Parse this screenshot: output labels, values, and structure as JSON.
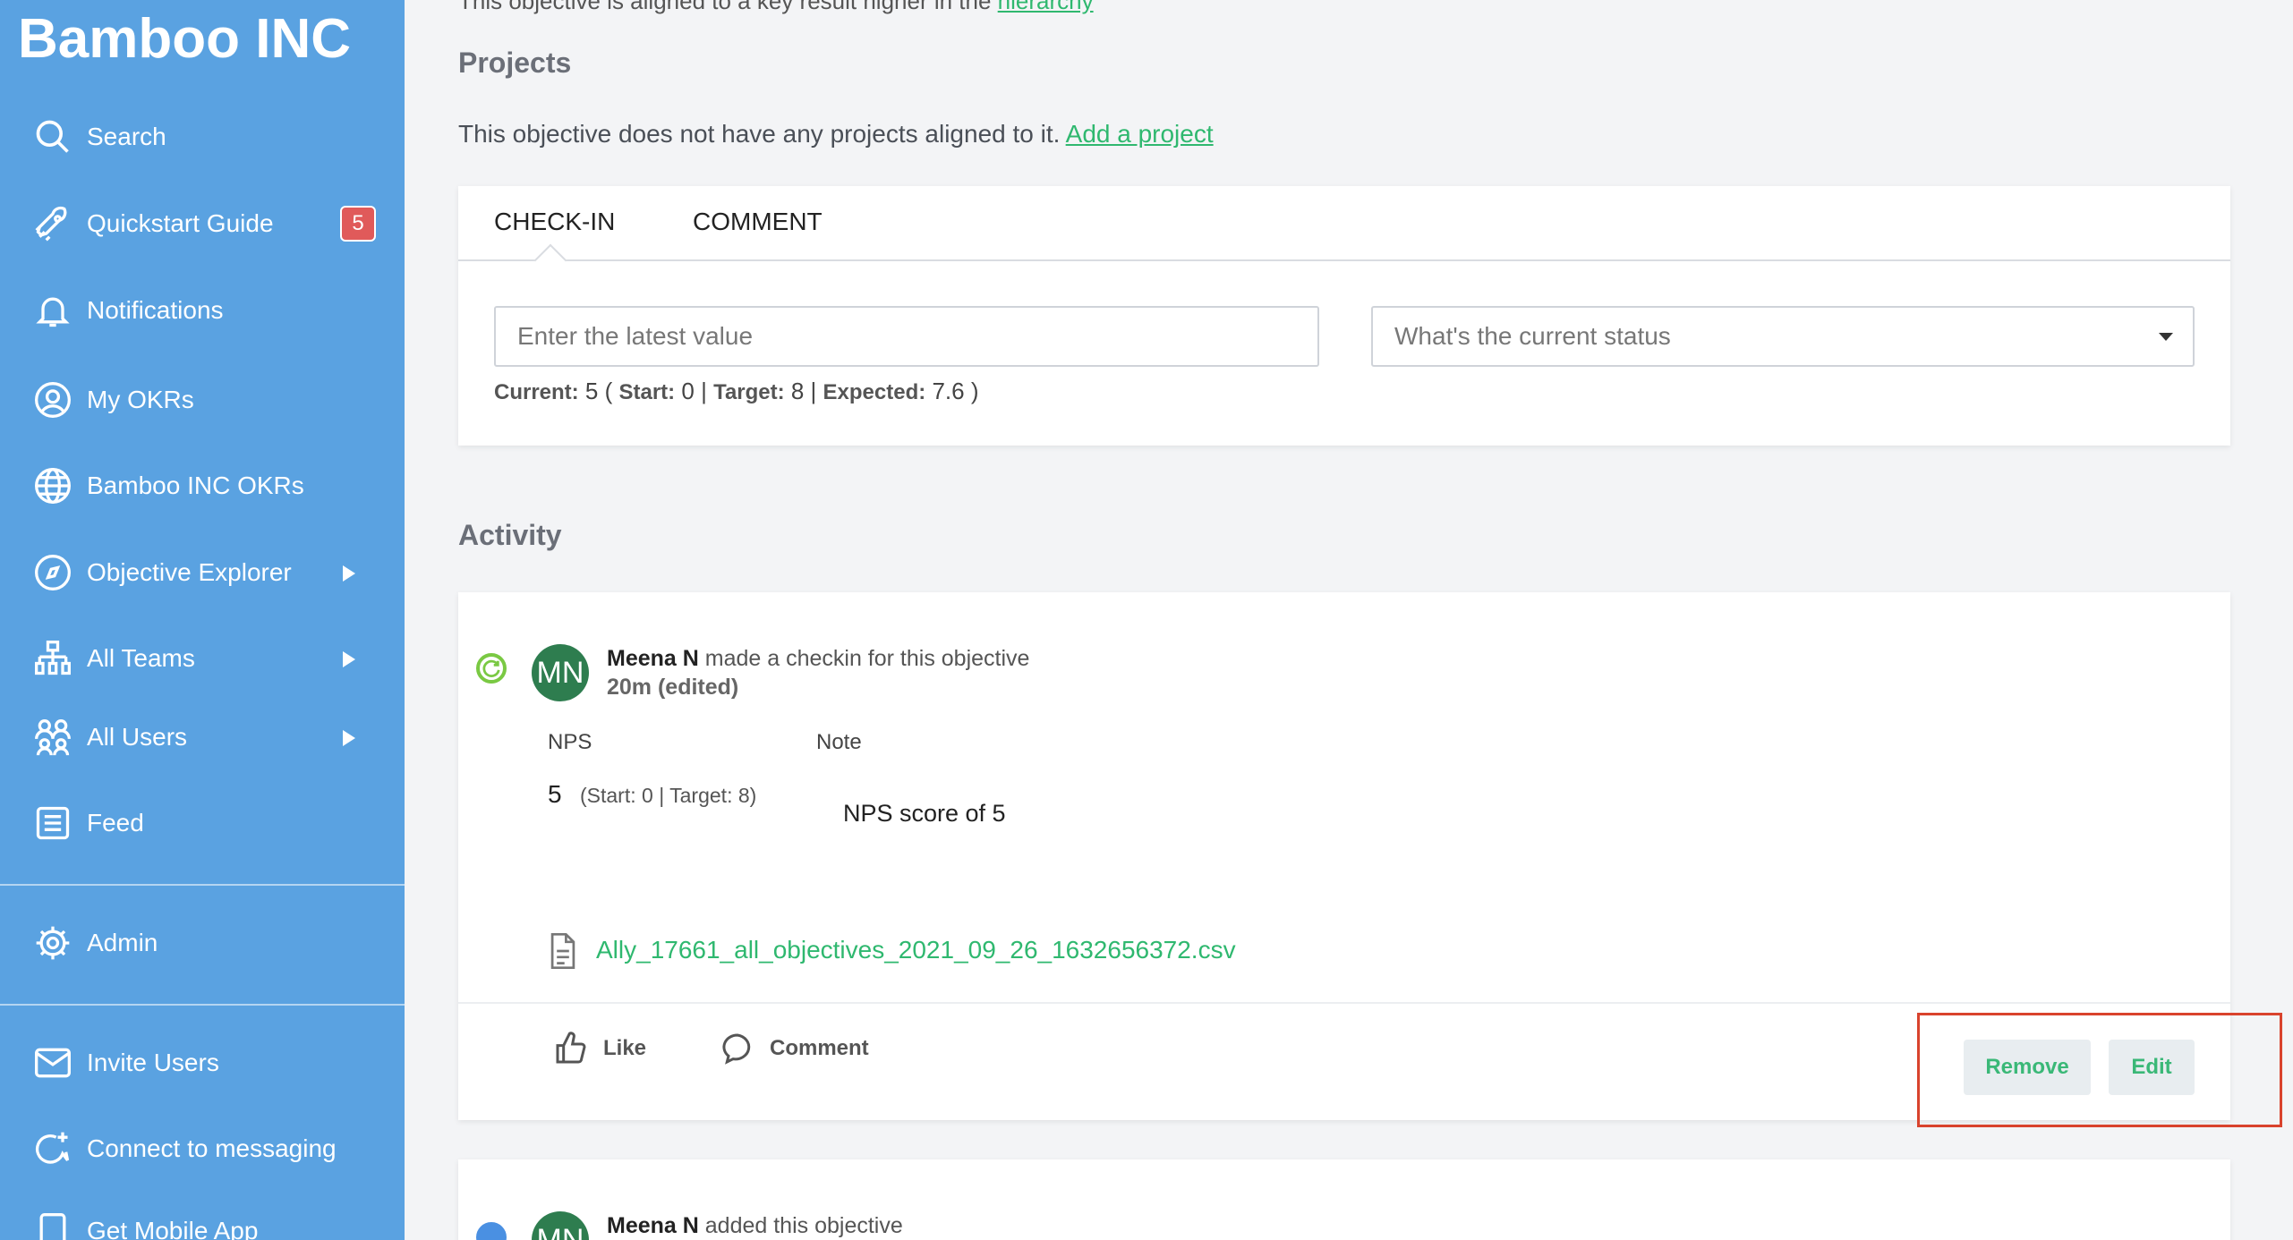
{
  "sidebar": {
    "brand": "Bamboo INC",
    "items": [
      {
        "label": "Search",
        "icon": "search-icon"
      },
      {
        "label": "Quickstart Guide",
        "icon": "rocket-icon",
        "badge": "5"
      },
      {
        "label": "Notifications",
        "icon": "bell-icon"
      },
      {
        "label": "My OKRs",
        "icon": "user-circle-icon"
      },
      {
        "label": "Bamboo INC OKRs",
        "icon": "globe-icon"
      },
      {
        "label": "Objective Explorer",
        "icon": "compass-icon"
      },
      {
        "label": "All Teams",
        "icon": "org-chart-icon"
      },
      {
        "label": "All Users",
        "icon": "users-icon"
      },
      {
        "label": "Feed",
        "icon": "feed-icon"
      },
      {
        "label": "Admin",
        "icon": "gear-icon"
      },
      {
        "label": "Invite Users",
        "icon": "mail-icon"
      },
      {
        "label": "Connect to messaging",
        "icon": "chat-plus-icon"
      },
      {
        "label": "Get Mobile App",
        "icon": "mobile-icon"
      }
    ]
  },
  "top_fragment": {
    "text": "This objective is aligned to a key result higher in the",
    "link": "hierarchy"
  },
  "projects": {
    "title": "Projects",
    "text": "This objective does not have any projects aligned to it.",
    "link": "Add a project"
  },
  "checkin": {
    "tabs": [
      "CHECK-IN",
      "COMMENT"
    ],
    "value_placeholder": "Enter the latest value",
    "status_placeholder": "What's the current status",
    "current_label": "Current:",
    "current_value": "5",
    "start_label": "Start:",
    "start_value": "0",
    "target_label": "Target:",
    "target_value": "8",
    "expected_label": "Expected:",
    "expected_value": "7.6"
  },
  "activity": {
    "title": "Activity",
    "entries": [
      {
        "avatar": "MN",
        "user": "Meena N",
        "action": "made a checkin for this objective",
        "time": "20m (edited)",
        "col_metric": "NPS",
        "col_note": "Note",
        "value": "5",
        "value_detail": "(Start: 0 | Target: 8)",
        "note": "NPS score of 5",
        "attachment": "Ally_17661_all_objectives_2021_09_26_1632656372.csv",
        "like_label": "Like",
        "comment_label": "Comment",
        "remove_label": "Remove",
        "edit_label": "Edit"
      },
      {
        "avatar": "MN",
        "user": "Meena N",
        "action": "added this objective"
      }
    ]
  },
  "colors": {
    "sidebar": "#5aa2e1",
    "link_green": "#2fb86f",
    "badge_red": "#e05a5a",
    "avatar_green": "#2e7d4f",
    "highlight_red": "#d9432d"
  }
}
